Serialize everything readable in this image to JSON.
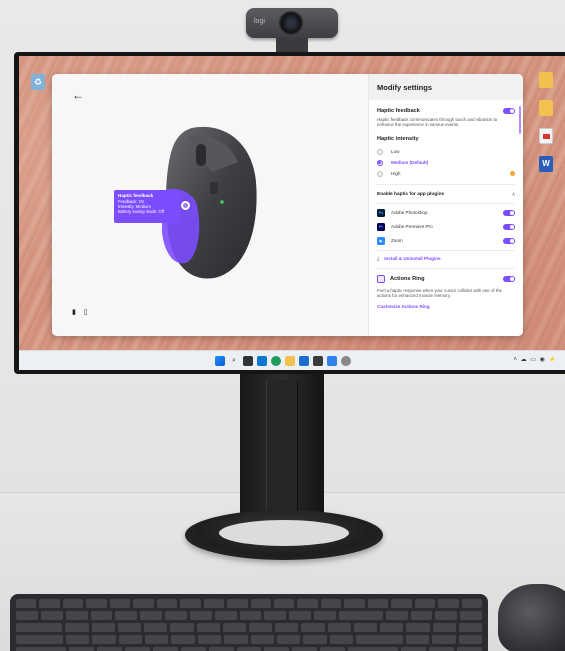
{
  "webcam": {
    "logo": "logi"
  },
  "app": {
    "panel_title": "Modify settings",
    "tooltip": {
      "title": "Haptic feedback",
      "lines": [
        "Feedback: On",
        "Intensity: Medium",
        "Battery saving mode: Off"
      ]
    },
    "haptic_feedback": {
      "title": "Haptic feedback",
      "description": "Haptic feedback communicates through touch and vibration to enhance the experience in various events.",
      "enabled": true
    },
    "haptic_intensity": {
      "title": "Haptic intensity",
      "options": [
        "Low",
        "Medium (Default)",
        "High"
      ],
      "selected": "Medium (Default)"
    },
    "plugins": {
      "title": "Enable haptic for app plugins",
      "items": [
        {
          "name": "Adobe Photoshop",
          "icon": "Ps",
          "enabled": true
        },
        {
          "name": "Adobe Premiere Pro",
          "icon": "Pr",
          "enabled": true
        },
        {
          "name": "Zoom",
          "icon": "zoom-icon",
          "enabled": true
        }
      ],
      "install_link": "Install & Uninstall Plugins"
    },
    "actions_ring": {
      "title": "Actions Ring",
      "description": "Feel a haptic response when your cursor collides with one of the actions for enhanced muscle memory.",
      "enabled": true,
      "link": "Customize Actions Ring"
    }
  },
  "colors": {
    "accent": "#7b4dff",
    "warning": "#f0a830"
  }
}
